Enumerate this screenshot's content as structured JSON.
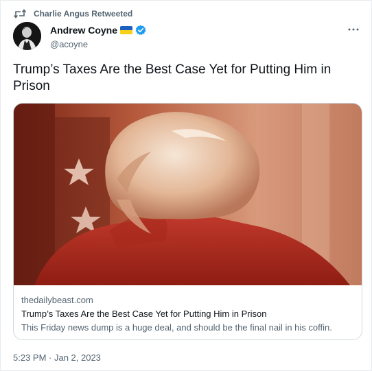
{
  "retweet": {
    "icon": "retweet-icon",
    "label": "Charlie Angus Retweeted"
  },
  "author": {
    "display_name": "Andrew Coyne",
    "handle": "@acoyne",
    "flag_icon": "ukraine-flag-icon",
    "flag_colors": [
      "#1f5fbf",
      "#f7d117"
    ],
    "verified_icon": "verified-badge-icon",
    "verified_color": "#1d9bf0"
  },
  "tweet": {
    "text": "Trump’s Taxes Are the Best Case Yet for Putting Him in Prison",
    "timestamp": "5:23 PM · Jan 2, 2023"
  },
  "link_card": {
    "domain": "thedailybeast.com",
    "title": "Trump’s Taxes Are the Best Case Yet for Putting Him in Prison",
    "description": "This Friday news dump is a huge deal, and should be the final nail in his coffin."
  },
  "more_icon": "more-horizontal-icon",
  "colors": {
    "primary_text": "#0f1419",
    "secondary_text": "#536471",
    "border": "#cfd9de",
    "image_tint": "#c0392b"
  }
}
